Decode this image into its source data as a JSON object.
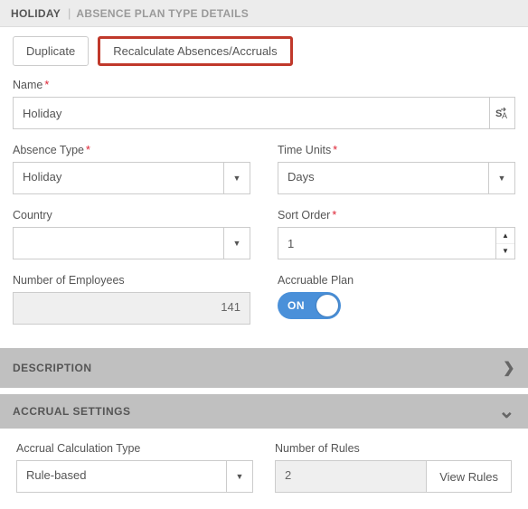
{
  "header": {
    "tab_main": "HOLIDAY",
    "tab_sub": "ABSENCE PLAN TYPE DETAILS"
  },
  "toolbar": {
    "duplicate": "Duplicate",
    "recalc": "Recalculate Absences/Accruals"
  },
  "fields": {
    "name_label": "Name",
    "name_value": "Holiday",
    "absence_type_label": "Absence Type",
    "absence_type_value": "Holiday",
    "time_units_label": "Time Units",
    "time_units_value": "Days",
    "country_label": "Country",
    "country_value": "",
    "sort_order_label": "Sort Order",
    "sort_order_value": "1",
    "num_employees_label": "Number of Employees",
    "num_employees_value": "141",
    "accruable_label": "Accruable Plan",
    "accruable_state": "ON"
  },
  "sections": {
    "description": "DESCRIPTION",
    "accrual_settings": "ACCRUAL SETTINGS"
  },
  "accrual": {
    "calc_type_label": "Accrual Calculation Type",
    "calc_type_value": "Rule-based",
    "num_rules_label": "Number of Rules",
    "num_rules_value": "2",
    "view_rules": "View Rules"
  },
  "glyphs": {
    "caret_down": "▼",
    "caret_up": "▲",
    "chevron_right": "❯",
    "chevron_down": "⌄"
  }
}
